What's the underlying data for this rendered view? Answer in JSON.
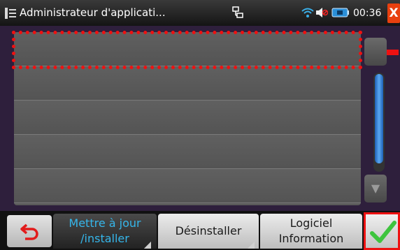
{
  "statusbar": {
    "title": "Administrateur d'applicati...",
    "time": "00:36",
    "close_label": "X",
    "icons": [
      "app-menu-icon",
      "network-icon",
      "wifi-icon",
      "speaker-muted-icon",
      "battery-icon"
    ]
  },
  "list": {
    "rows": [
      "",
      "",
      "",
      "",
      ""
    ]
  },
  "scrollbar": {
    "up_glyph": "▲",
    "down_glyph": "▼"
  },
  "bottombar": {
    "back_icon": "back-arrow-icon",
    "tab_update_line1": "Mettre à jour",
    "tab_update_line2": "/installer",
    "tab_uninstall": "Désinstaller",
    "tab_info_line1": "Logiciel",
    "tab_info_line2": "Information",
    "confirm_icon": "checkmark-icon"
  },
  "colors": {
    "active_tab_text": "#35b6ea",
    "highlight": "#ee1111",
    "close_button": "#e8400f",
    "scroll_thumb": "#3a8ee0",
    "check": "#3ec43e"
  }
}
